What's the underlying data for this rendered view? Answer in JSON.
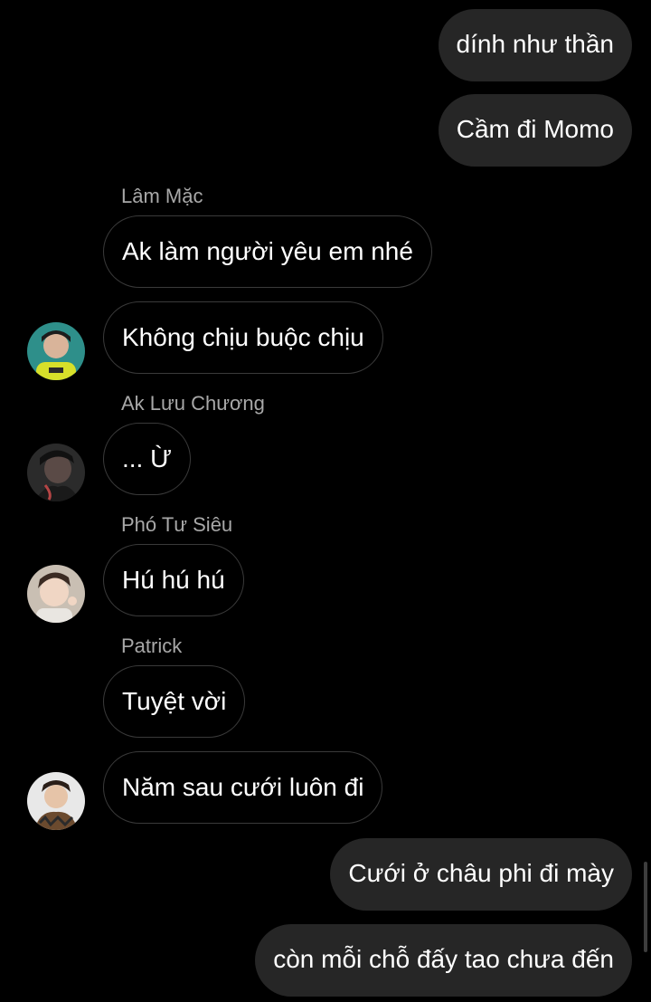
{
  "messages": {
    "out_1": "dính như thần",
    "out_2": "Cầm đi Momo",
    "lam_mac_name": "Lâm Mặc",
    "lam_mac_1": "Ak làm người yêu em nhé",
    "lam_mac_2": "Không chịu buộc chịu",
    "ak_name": "Ak Lưu Chương",
    "ak_1": "... Ừ",
    "pho_name": "Phó Tư Siêu",
    "pho_1": "Hú hú hú",
    "patrick_name": "Patrick",
    "patrick_1": "Tuyệt vời",
    "patrick_2": "Năm sau cưới luôn đi",
    "out_3": "Cưới ở châu phi đi mày",
    "out_4": "còn mỗi chỗ đấy tao chưa đến"
  },
  "avatars": {
    "lam_mac": "avatar-photo-lam-mac",
    "ak": "avatar-photo-ak-luu-chuong",
    "pho": "avatar-photo-pho-tu-sieu",
    "patrick": "avatar-photo-patrick"
  },
  "colors": {
    "background": "#000000",
    "outgoing_bubble": "#262626",
    "incoming_border": "#3a3a3a",
    "sender_name": "#a8a8a8",
    "text": "#ffffff"
  }
}
